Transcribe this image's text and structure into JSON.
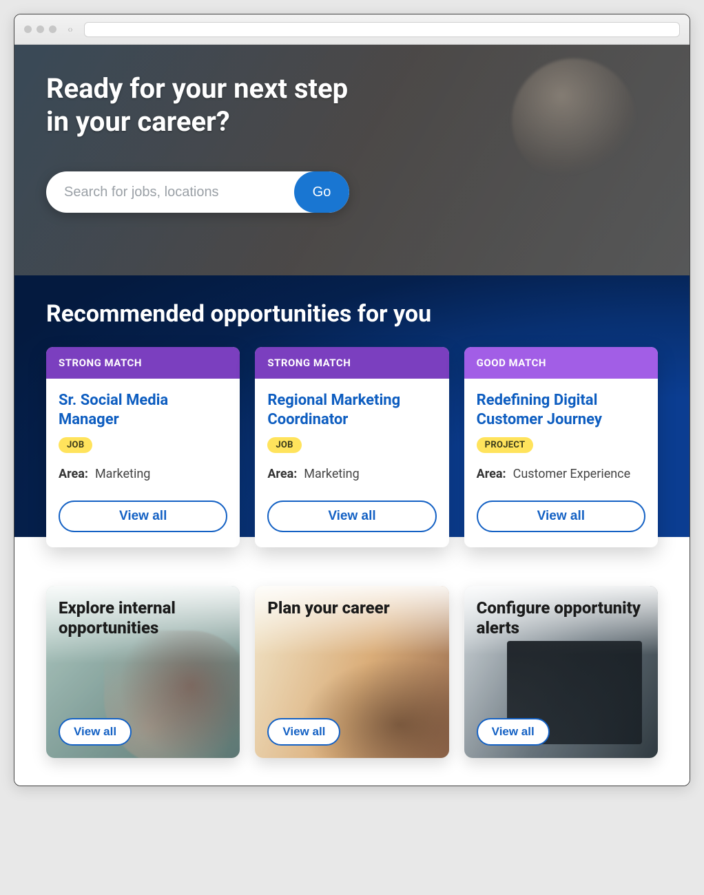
{
  "hero": {
    "headline_l1": "Ready for your next step",
    "headline_l2": "in your career?",
    "search_placeholder": "Search for jobs, locations",
    "go_label": "Go"
  },
  "recommended": {
    "title": "Recommended opportunities for you",
    "view_all_label": "View all",
    "cards": [
      {
        "match": "STRONG MATCH",
        "match_kind": "strong",
        "title": "Sr. Social Media Manager",
        "badge": "JOB",
        "area_label": "Area:",
        "area_value": "Marketing"
      },
      {
        "match": "STRONG MATCH",
        "match_kind": "strong",
        "title": "Regional Marketing Coordinator",
        "badge": "JOB",
        "area_label": "Area:",
        "area_value": "Marketing"
      },
      {
        "match": "GOOD MATCH",
        "match_kind": "good",
        "title": "Redefining Digital Customer Journey",
        "badge": "PROJECT",
        "area_label": "Area:",
        "area_value": "Customer Experience"
      }
    ]
  },
  "tiles": {
    "view_all_label": "View all",
    "items": [
      {
        "title": "Explore internal opportunities"
      },
      {
        "title": "Plan your career"
      },
      {
        "title": "Configure opportunity alerts"
      }
    ]
  }
}
